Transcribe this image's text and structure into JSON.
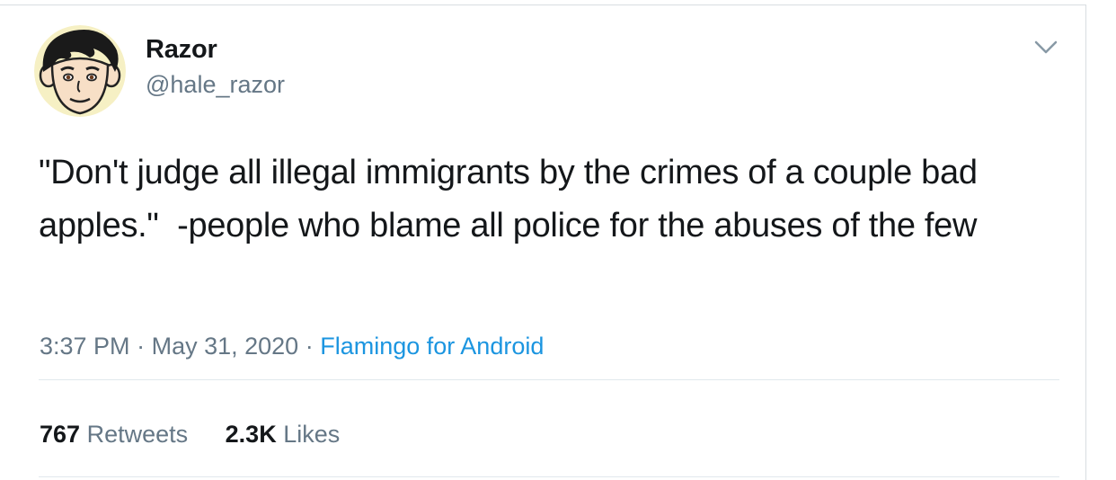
{
  "user": {
    "display_name": "Razor",
    "handle": "@hale_razor"
  },
  "tweet": {
    "text": "\"Don't judge all illegal immigrants by the crimes of a couple bad apples.\"  -people who blame all police for the abuses of the few"
  },
  "meta": {
    "time": "3:37 PM",
    "separator": "·",
    "date": "May 31, 2020",
    "source": "Flamingo for Android"
  },
  "stats": {
    "retweets_count": "767",
    "retweets_label": "Retweets",
    "likes_count": "2.3K",
    "likes_label": "Likes"
  },
  "icons": {
    "menu": "chevron-down-icon",
    "avatar": "cartoon-face-avatar"
  },
  "colors": {
    "text": "#14171a",
    "secondary": "#657786",
    "link": "#1b95e0",
    "border": "#e1e8ed"
  }
}
